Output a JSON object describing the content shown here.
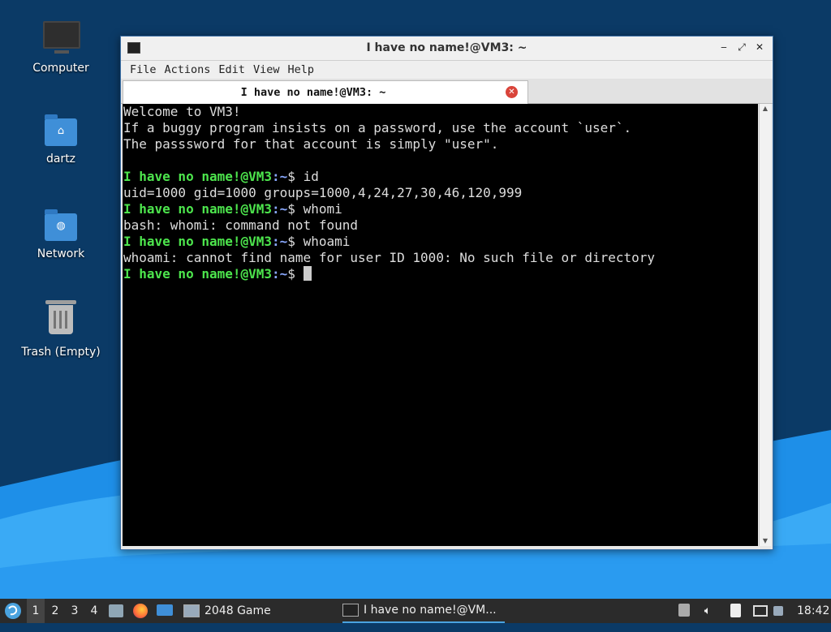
{
  "desktop": {
    "icons": [
      {
        "label": "Computer"
      },
      {
        "label": "dartz"
      },
      {
        "label": "Network"
      },
      {
        "label": "Trash (Empty)"
      }
    ]
  },
  "window": {
    "title": "I have no name!@VM3: ~",
    "menu": [
      "File",
      "Actions",
      "Edit",
      "View",
      "Help"
    ],
    "tab_title": "I have no name!@VM3: ~",
    "terminal": {
      "motd": [
        "Welcome to VM3!",
        "If a buggy program insists on a password, use the account `user`.",
        "The passsword for that account is simply \"user\"."
      ],
      "prompt_user": "I have no name!@VM3",
      "prompt_cwd": ":~",
      "prompt_sym": "$ ",
      "entries": [
        {
          "cmd": "id",
          "output": "uid=1000 gid=1000 groups=1000,4,24,27,30,46,120,999"
        },
        {
          "cmd": "whomi",
          "output": "bash: whomi: command not found"
        },
        {
          "cmd": "whoami",
          "output": "whoami: cannot find name for user ID 1000: No such file or directory"
        }
      ]
    }
  },
  "taskbar": {
    "workspaces": [
      "1",
      "2",
      "3",
      "4"
    ],
    "active_workspace": "1",
    "apps": [
      {
        "label": "2048 Game"
      },
      {
        "label": "I have no name!@VM..."
      }
    ],
    "clock": "18:42"
  },
  "colors": {
    "prompt": "#4de54d",
    "cwd": "#8aa9ff",
    "desktop_bg": "#0b3a66",
    "accent": "#4aa3df"
  }
}
